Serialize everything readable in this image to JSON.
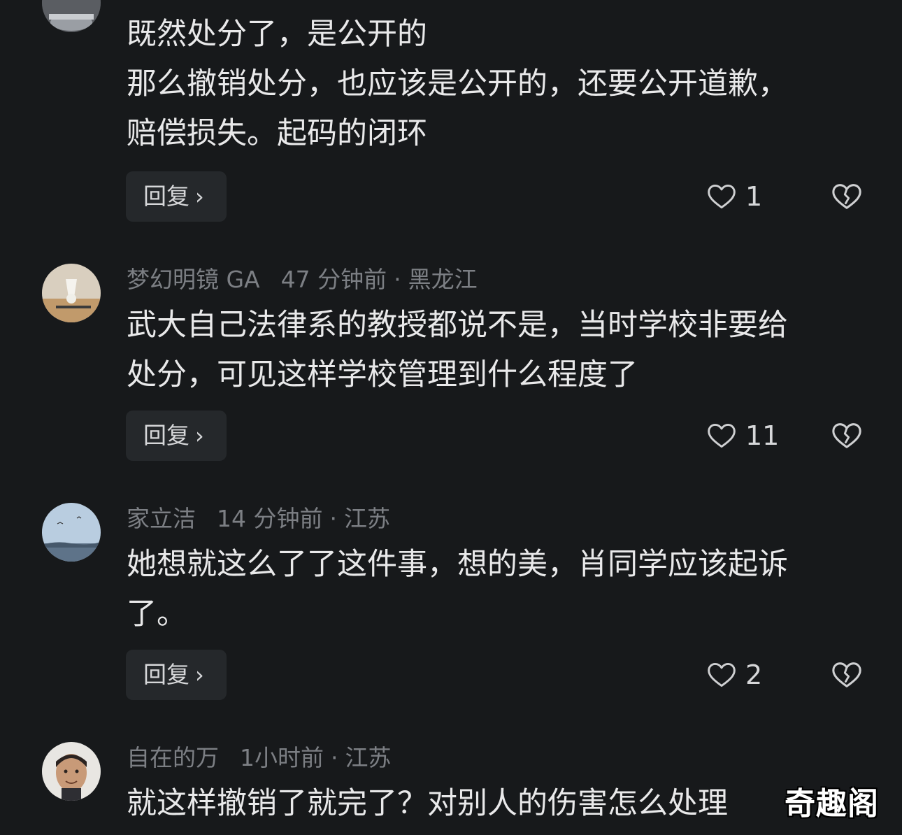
{
  "comments": [
    {
      "username": "",
      "time": "",
      "location": "",
      "lines": [
        "既然处分了，是公开的",
        "那么撤销处分，也应该是公开的，还要公开道歉，",
        "赔偿损失。起码的闭环"
      ],
      "reply_label": "回复",
      "likes": "1"
    },
    {
      "username": "梦幻明镜 GA",
      "time": "47 分钟前",
      "location": "黑龙江",
      "lines": [
        "武大自己法律系的教授都说不是，当时学校非要给",
        "处分，可见这样学校管理到什么程度了"
      ],
      "reply_label": "回复",
      "likes": "11"
    },
    {
      "username": "家立洁",
      "time": "14 分钟前",
      "location": "江苏",
      "lines": [
        "她想就这么了了这件事，想的美，肖同学应该起诉",
        "了。"
      ],
      "reply_label": "回复",
      "likes": "2"
    },
    {
      "username": "自在的万",
      "time": "1小时前",
      "location": "江苏",
      "lines": [
        "就这样撤销了就完了？对别人的伤害怎么处理"
      ],
      "reply_label": "",
      "likes": ""
    }
  ],
  "separator": "·",
  "reply_chevron": "›",
  "icons": {
    "like": "heart-outline-icon",
    "dislike": "broken-heart-icon"
  },
  "colors": {
    "background": "#17191b",
    "text": "#e9e9ea",
    "meta": "#7c7f84",
    "button_bg": "#25282b"
  },
  "watermark": "奇趣阁"
}
